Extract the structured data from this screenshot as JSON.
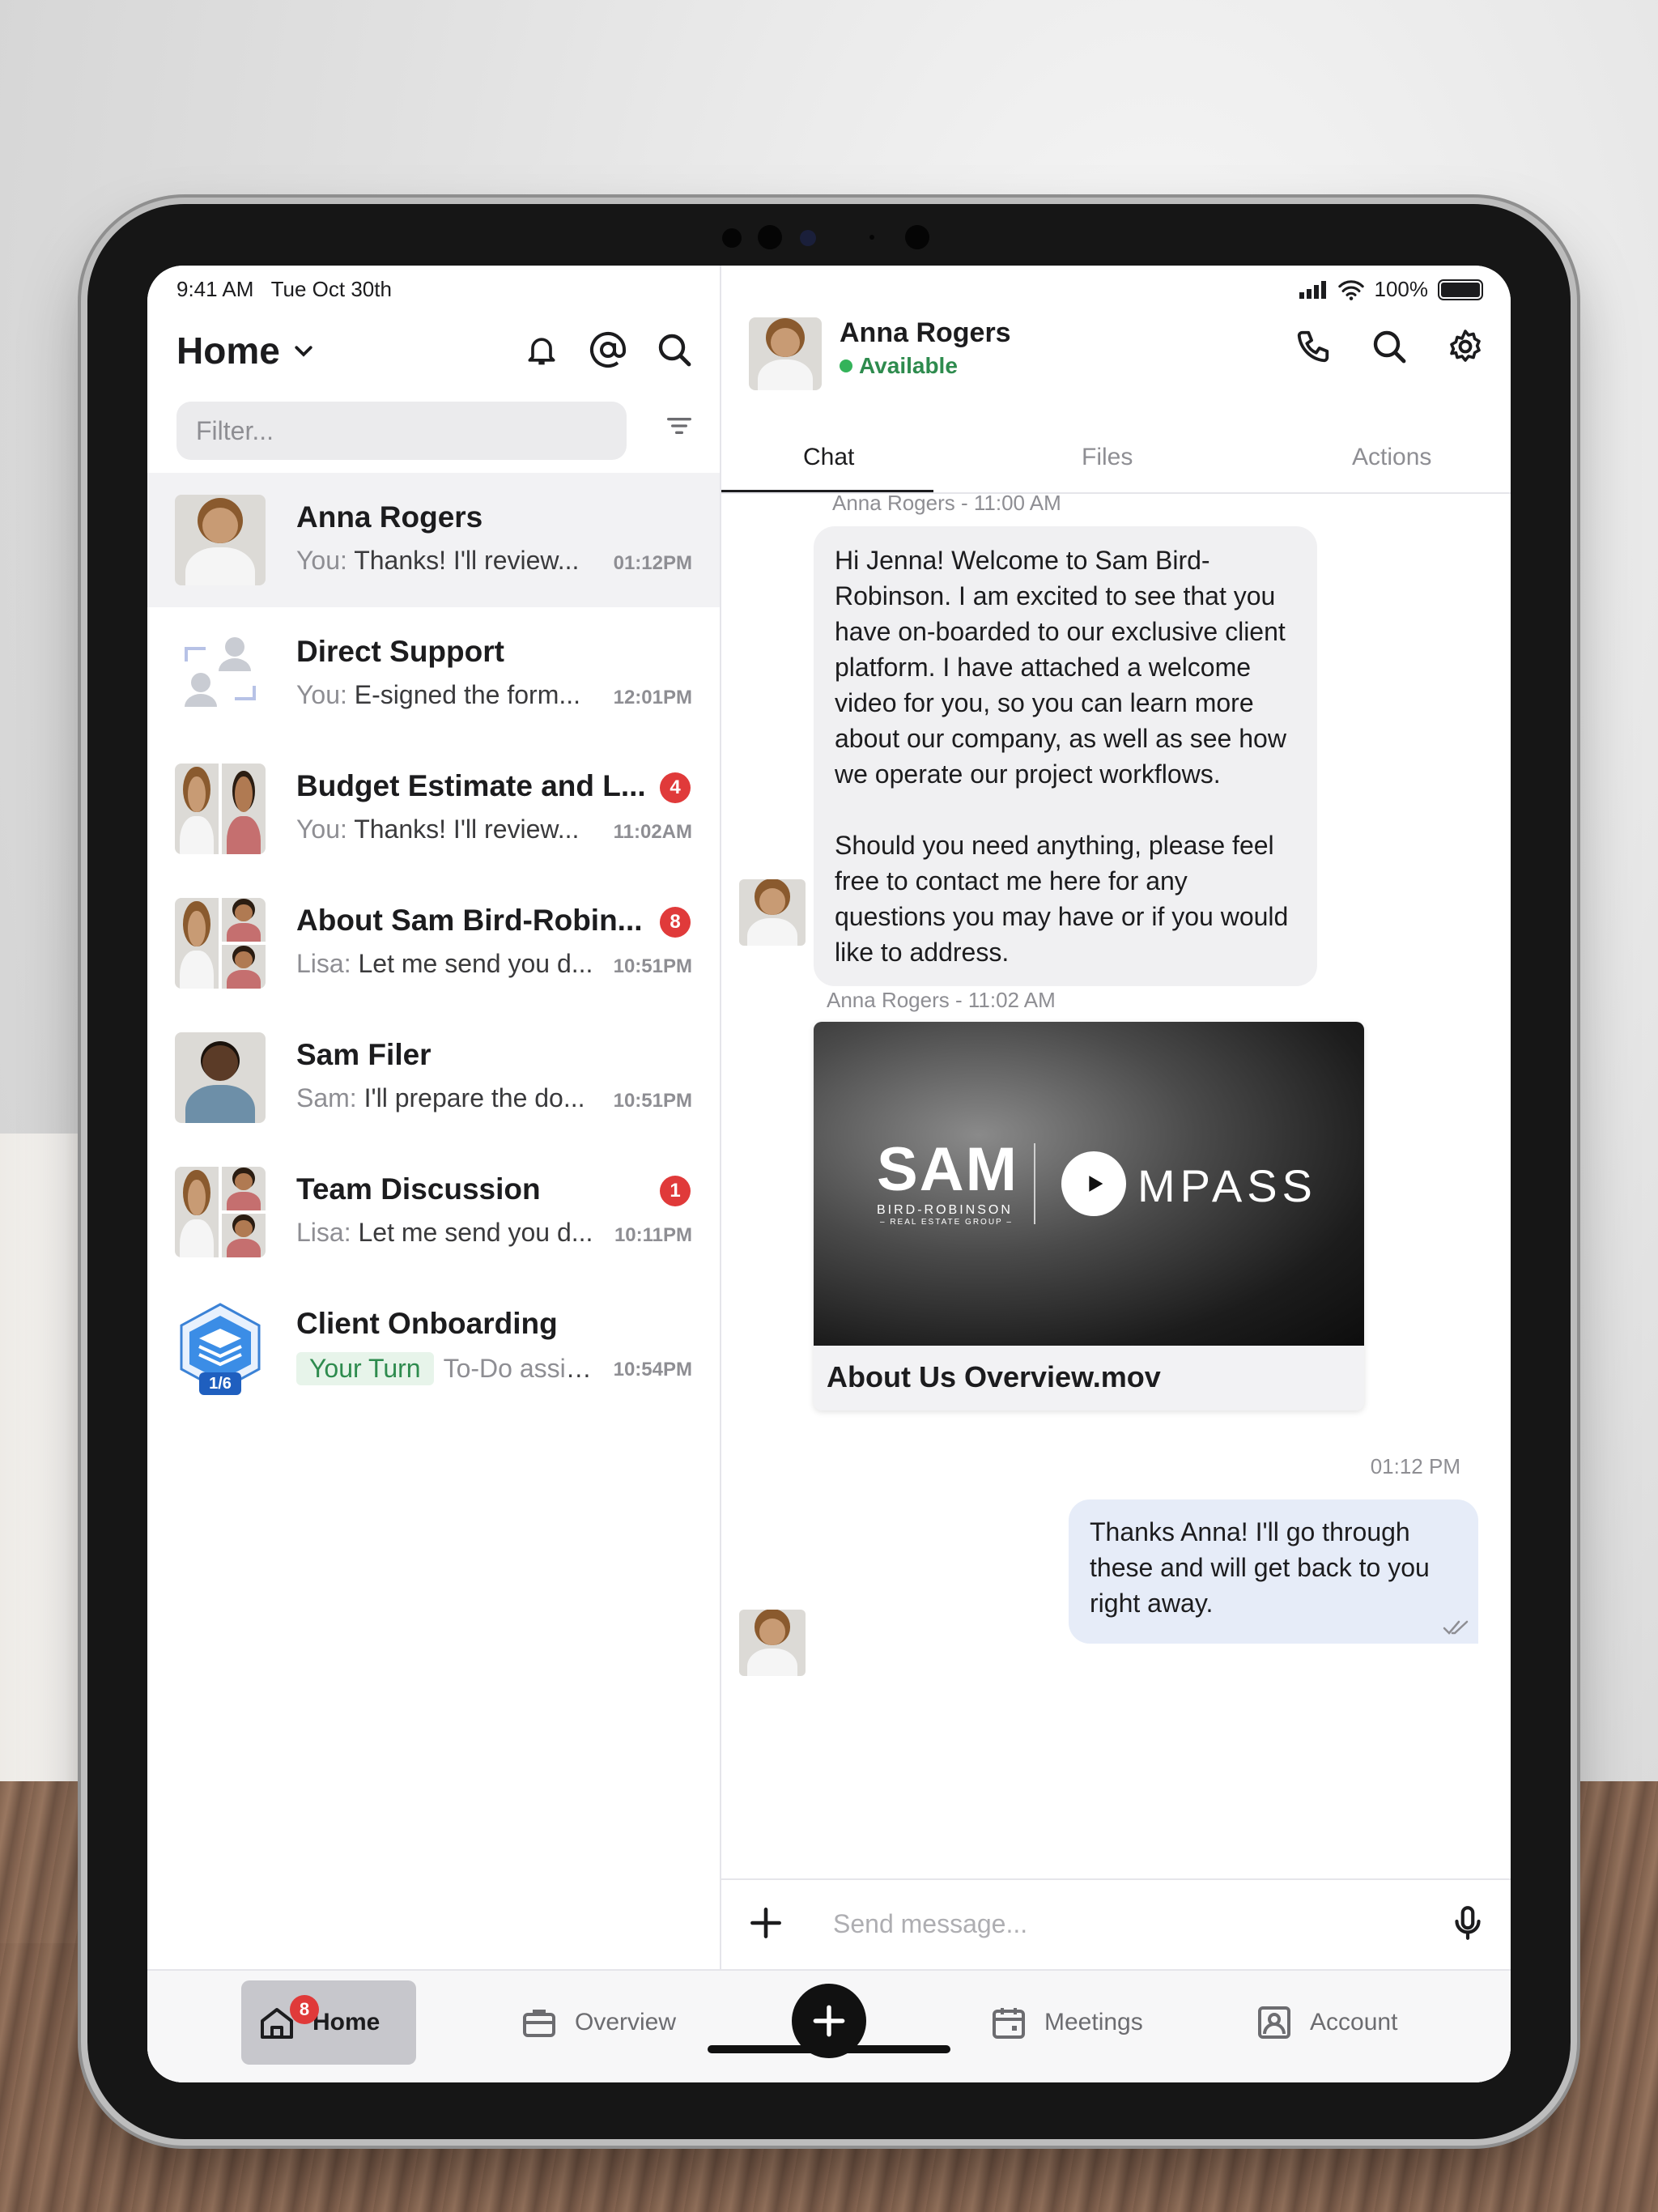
{
  "status_bar": {
    "time": "9:41 AM",
    "date": "Tue Oct 30th",
    "battery": "100%"
  },
  "sidebar": {
    "title": "Home",
    "filter_placeholder": "Filter...",
    "conversations": [
      {
        "name": "Anna Rogers",
        "who": "You:",
        "preview": "Thanks! I'll review...",
        "time": "01:12PM",
        "badge": ""
      },
      {
        "name": "Direct Support",
        "who": "You:",
        "preview": "E-signed the form...",
        "time": "12:01PM",
        "badge": ""
      },
      {
        "name": "Budget Estimate and L...",
        "who": "You:",
        "preview": "Thanks! I'll review...",
        "time": "11:02AM",
        "badge": "4"
      },
      {
        "name": "About Sam Bird-Robin...",
        "who": "Lisa:",
        "preview": "Let me send you d...",
        "time": "10:51PM",
        "badge": "8"
      },
      {
        "name": "Sam Filer",
        "who": "Sam:",
        "preview": "I'll prepare the do...",
        "time": "10:51PM",
        "badge": ""
      },
      {
        "name": "Team Discussion",
        "who": "Lisa:",
        "preview": "Let me send you d...",
        "time": "10:11PM",
        "badge": "1"
      },
      {
        "name": "Client Onboarding",
        "turn": "Your Turn",
        "preview": "To-Do assign...",
        "time": "10:54PM",
        "progress": "1/6"
      }
    ]
  },
  "chat": {
    "contact_name": "Anna Rogers",
    "contact_status": "Available",
    "tabs": [
      "Chat",
      "Files",
      "Actions"
    ],
    "messages": [
      {
        "meta": "Anna Rogers - 11:00 AM",
        "text": "Hi Jenna! Welcome to Sam Bird-Robinson. I am excited to see that you have on-boarded to our exclusive client platform. I have attached a welcome video for you, so you can learn more about our company, as well as see how we operate our project workflows.\n\nShould you need anything, please feel free to contact me here for any questions you may have or if you would like to address."
      },
      {
        "meta": "Anna Rogers - 11:02 AM",
        "video_logo": "SAM",
        "video_logo_sub": "BIRD-ROBINSON",
        "video_logo_sub2": "– REAL ESTATE GROUP –",
        "video_partner": "MPASS",
        "file_name": "About Us Overview.mov"
      },
      {
        "meta": "01:12 PM",
        "text": "Thanks Anna! I'll go through these and will get back to you right away."
      }
    ],
    "composer_placeholder": "Send message..."
  },
  "tabbar": {
    "items": [
      "Home",
      "Overview",
      "Meetings",
      "Account"
    ],
    "home_badge": "8"
  }
}
